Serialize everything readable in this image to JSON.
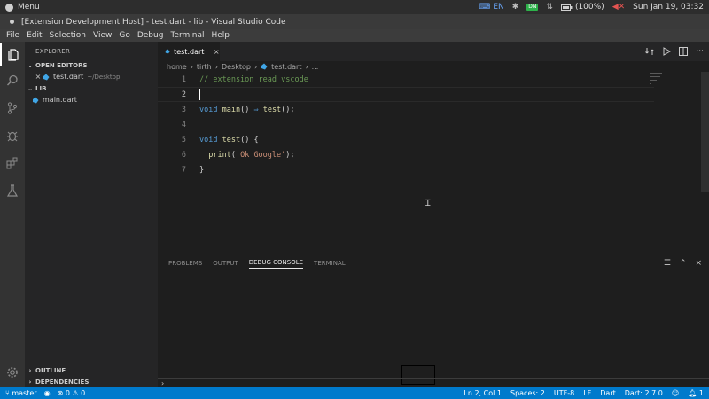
{
  "os_bar": {
    "menu_label": "Menu",
    "keyboard_layout": "EN",
    "battery": "(100%)",
    "clock": "Sun Jan 19, 03:32",
    "tray_badge": "DN"
  },
  "window": {
    "title": "[Extension Development Host] - test.dart - lib - Visual Studio Code"
  },
  "menu": [
    "File",
    "Edit",
    "Selection",
    "View",
    "Go",
    "Debug",
    "Terminal",
    "Help"
  ],
  "sidebar": {
    "title": "EXPLORER",
    "open_editors_label": "OPEN EDITORS",
    "open_file": {
      "name": "test.dart",
      "path": "~/Desktop"
    },
    "folder_label": "LIB",
    "folder_files": [
      "main.dart"
    ],
    "outline_label": "OUTLINE",
    "dependencies_label": "DEPENDENCIES"
  },
  "editor": {
    "tab_label": "test.dart",
    "breadcrumb": [
      "home",
      "tirth",
      "Desktop",
      "test.dart",
      "..."
    ],
    "lines": [
      {
        "n": "1",
        "text": "// extension read vscode"
      },
      {
        "n": "2",
        "text": ""
      },
      {
        "n": "3",
        "text": "void main() => test();"
      },
      {
        "n": "4",
        "text": ""
      },
      {
        "n": "5",
        "text": "void test() {"
      },
      {
        "n": "6",
        "text": "  print('Ok Google');"
      },
      {
        "n": "7",
        "text": "}"
      }
    ]
  },
  "panel": {
    "tabs": [
      "PROBLEMS",
      "OUTPUT",
      "DEBUG CONSOLE",
      "TERMINAL"
    ],
    "active_tab": "DEBUG CONSOLE",
    "prompt": "›"
  },
  "status": {
    "branch": "master",
    "errors": "0",
    "warnings": "0",
    "position": "Ln 2, Col 1",
    "spaces": "Spaces: 2",
    "encoding": "UTF-8",
    "eol": "LF",
    "language": "Dart",
    "sdk": "Dart: 2.7.0",
    "notifications": "1"
  },
  "colors": {
    "status_bar": "#007acc",
    "keyword": "#569cd6",
    "function": "#dcdcaa",
    "comment": "#6a9955",
    "string": "#ce9178"
  }
}
